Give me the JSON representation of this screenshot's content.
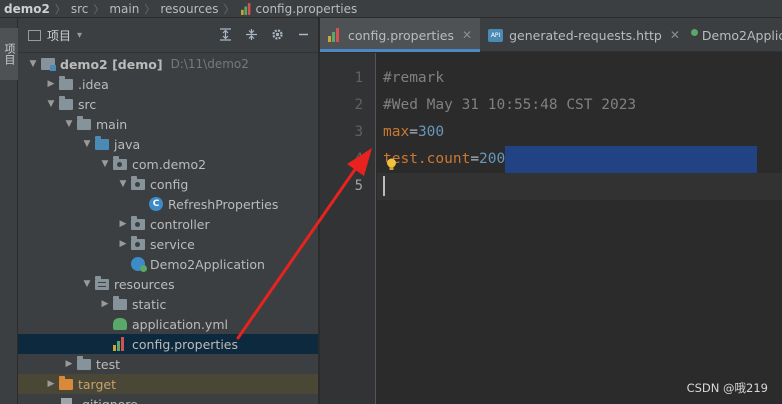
{
  "breadcrumb": [
    "demo2",
    "src",
    "main",
    "resources",
    "config.properties"
  ],
  "tool_strip": {
    "label": "项目"
  },
  "project_panel": {
    "title": "项目",
    "tools": [
      "expand-icon",
      "collapse-icon",
      "gear-icon",
      "minimize-icon"
    ]
  },
  "tree": [
    {
      "label": "demo2 [demo]",
      "path": "D:\\11\\demo2",
      "icon": "module",
      "arrow": "down",
      "indent": 0
    },
    {
      "label": ".idea",
      "icon": "folder",
      "arrow": "right",
      "indent": 1
    },
    {
      "label": "src",
      "icon": "folder",
      "arrow": "down",
      "indent": 1
    },
    {
      "label": "main",
      "icon": "folder",
      "arrow": "down",
      "indent": 2
    },
    {
      "label": "java",
      "icon": "folder-src",
      "arrow": "down",
      "indent": 3
    },
    {
      "label": "com.demo2",
      "icon": "package",
      "arrow": "down",
      "indent": 4
    },
    {
      "label": "config",
      "icon": "package",
      "arrow": "down",
      "indent": 5
    },
    {
      "label": "RefreshProperties",
      "icon": "class",
      "arrow": "",
      "indent": 6
    },
    {
      "label": "controller",
      "icon": "package",
      "arrow": "right",
      "indent": 5
    },
    {
      "label": "service",
      "icon": "package",
      "arrow": "right",
      "indent": 5
    },
    {
      "label": "Demo2Application",
      "icon": "app",
      "arrow": "",
      "indent": 5
    },
    {
      "label": "resources",
      "icon": "folder-res",
      "arrow": "down",
      "indent": 3
    },
    {
      "label": "static",
      "icon": "folder",
      "arrow": "right",
      "indent": 4
    },
    {
      "label": "application.yml",
      "icon": "yml",
      "arrow": "",
      "indent": 4
    },
    {
      "label": "config.properties",
      "icon": "props",
      "arrow": "",
      "indent": 4,
      "selected": true
    },
    {
      "label": "test",
      "icon": "folder",
      "arrow": "right",
      "indent": 2
    },
    {
      "label": "target",
      "icon": "folder-target",
      "arrow": "right",
      "indent": 1,
      "target": true
    },
    {
      "label": ".gitignore",
      "icon": "file",
      "arrow": "",
      "indent": 1
    }
  ],
  "tabs": [
    {
      "label": "config.properties",
      "icon": "props",
      "active": true,
      "closable": true
    },
    {
      "label": "generated-requests.http",
      "icon": "api",
      "active": false,
      "closable": true
    },
    {
      "label": "Demo2Applicatio",
      "icon": "app",
      "active": false,
      "closable": false
    }
  ],
  "editor": {
    "line_numbers": [
      "1",
      "2",
      "3",
      "4",
      "5"
    ],
    "lines": [
      {
        "comment": "#remark"
      },
      {
        "comment": "#Wed May 31 10:55:48 CST 2023"
      },
      {
        "key": "max",
        "eq": "=",
        "value": "300"
      },
      {
        "key": "test.count",
        "eq": "=",
        "value": "200",
        "selected": true
      },
      {
        "caret": true
      }
    ]
  },
  "watermark": "CSDN @哦219",
  "colors": {
    "accent": "#4a88c7",
    "selection": "#214283",
    "annotation_arrow": "#e8231f"
  }
}
